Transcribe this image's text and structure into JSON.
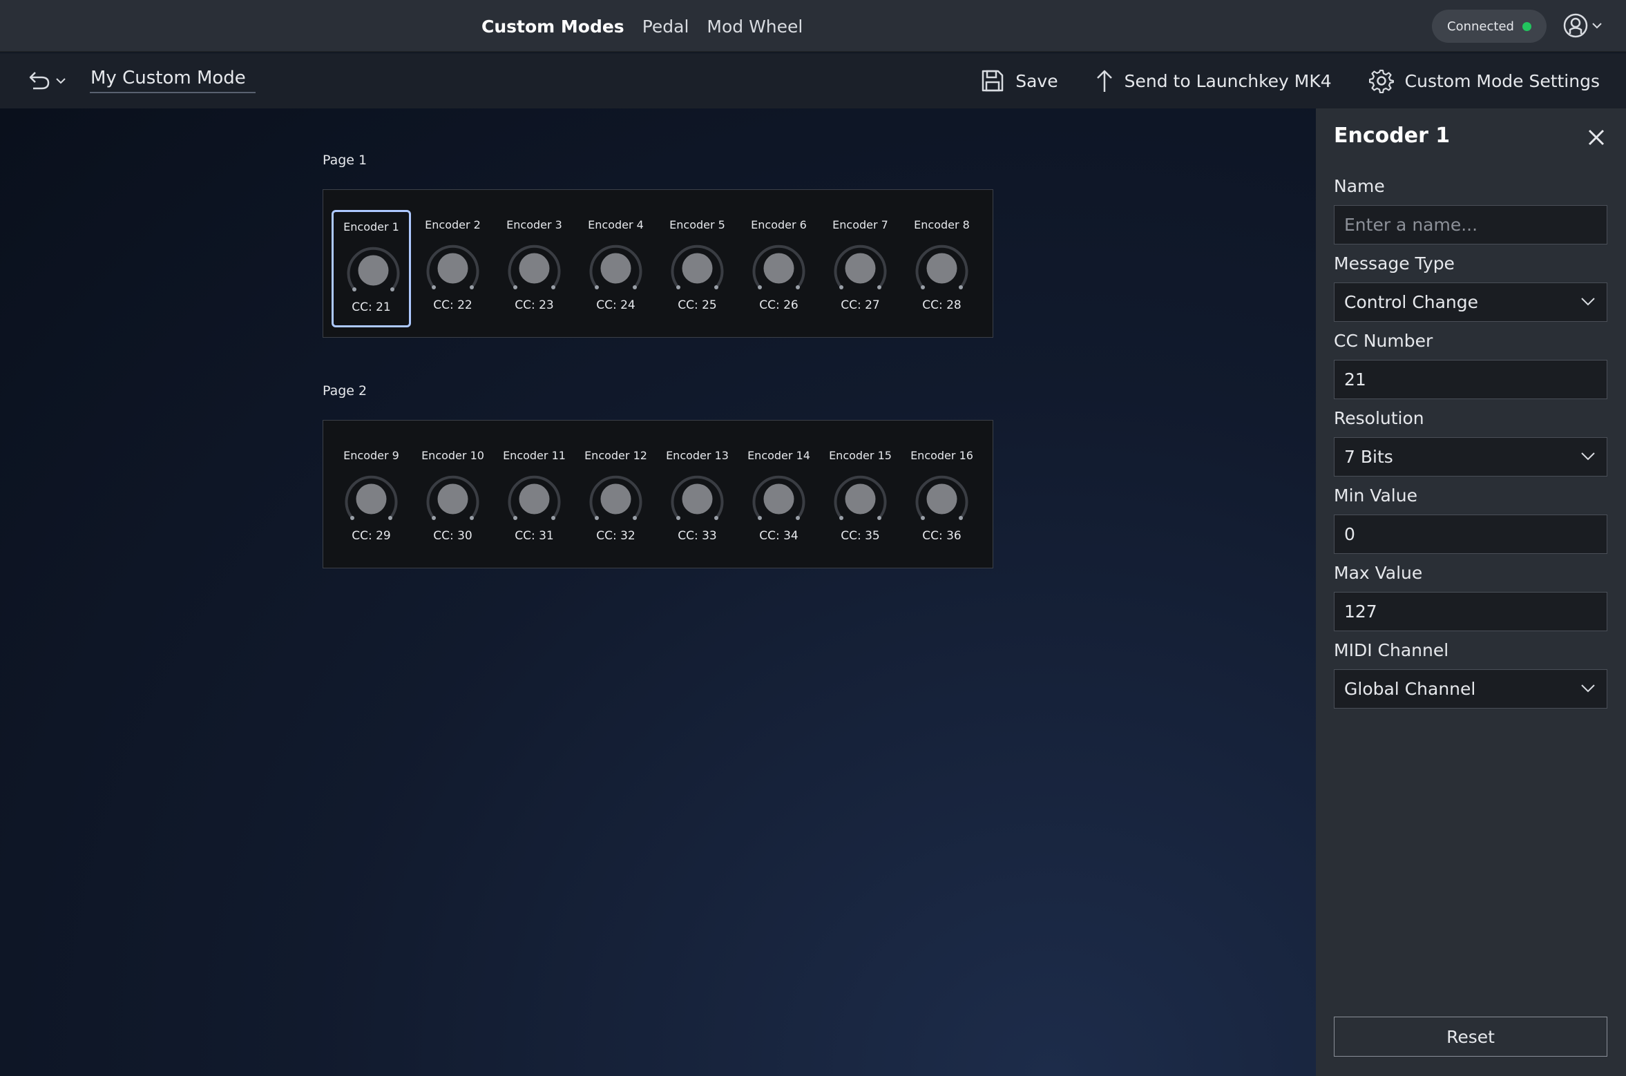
{
  "top_nav": {
    "tabs": [
      {
        "label": "Custom Modes"
      },
      {
        "label": "Pedal"
      },
      {
        "label": "Mod Wheel"
      }
    ],
    "connection_status": "Connected"
  },
  "toolbar": {
    "mode_name": "My Custom Mode",
    "save_label": "Save",
    "send_label": "Send to Launchkey MK4",
    "settings_label": "Custom Mode Settings"
  },
  "pages": [
    {
      "label": "Page 1",
      "encoders": [
        {
          "name": "Encoder 1",
          "cc": "CC: 21"
        },
        {
          "name": "Encoder 2",
          "cc": "CC: 22"
        },
        {
          "name": "Encoder 3",
          "cc": "CC: 23"
        },
        {
          "name": "Encoder 4",
          "cc": "CC: 24"
        },
        {
          "name": "Encoder 5",
          "cc": "CC: 25"
        },
        {
          "name": "Encoder 6",
          "cc": "CC: 26"
        },
        {
          "name": "Encoder 7",
          "cc": "CC: 27"
        },
        {
          "name": "Encoder 8",
          "cc": "CC: 28"
        }
      ]
    },
    {
      "label": "Page 2",
      "encoders": [
        {
          "name": "Encoder 9",
          "cc": "CC: 29"
        },
        {
          "name": "Encoder 10",
          "cc": "CC: 30"
        },
        {
          "name": "Encoder 11",
          "cc": "CC: 31"
        },
        {
          "name": "Encoder 12",
          "cc": "CC: 32"
        },
        {
          "name": "Encoder 13",
          "cc": "CC: 33"
        },
        {
          "name": "Encoder 14",
          "cc": "CC: 34"
        },
        {
          "name": "Encoder 15",
          "cc": "CC: 35"
        },
        {
          "name": "Encoder 16",
          "cc": "CC: 36"
        }
      ]
    }
  ],
  "panel": {
    "title": "Encoder 1",
    "name_label": "Name",
    "name_placeholder": "Enter a name...",
    "name_value": "",
    "message_type_label": "Message Type",
    "message_type_value": "Control Change",
    "cc_number_label": "CC Number",
    "cc_number_value": "21",
    "resolution_label": "Resolution",
    "resolution_value": "7 Bits",
    "min_value_label": "Min Value",
    "min_value_value": "0",
    "max_value_label": "Max Value",
    "max_value_value": "127",
    "midi_channel_label": "MIDI Channel",
    "midi_channel_value": "Global Channel",
    "reset_label": "Reset"
  },
  "colors": {
    "accent_selected": "#aec9ff",
    "connected": "#22c55e"
  }
}
